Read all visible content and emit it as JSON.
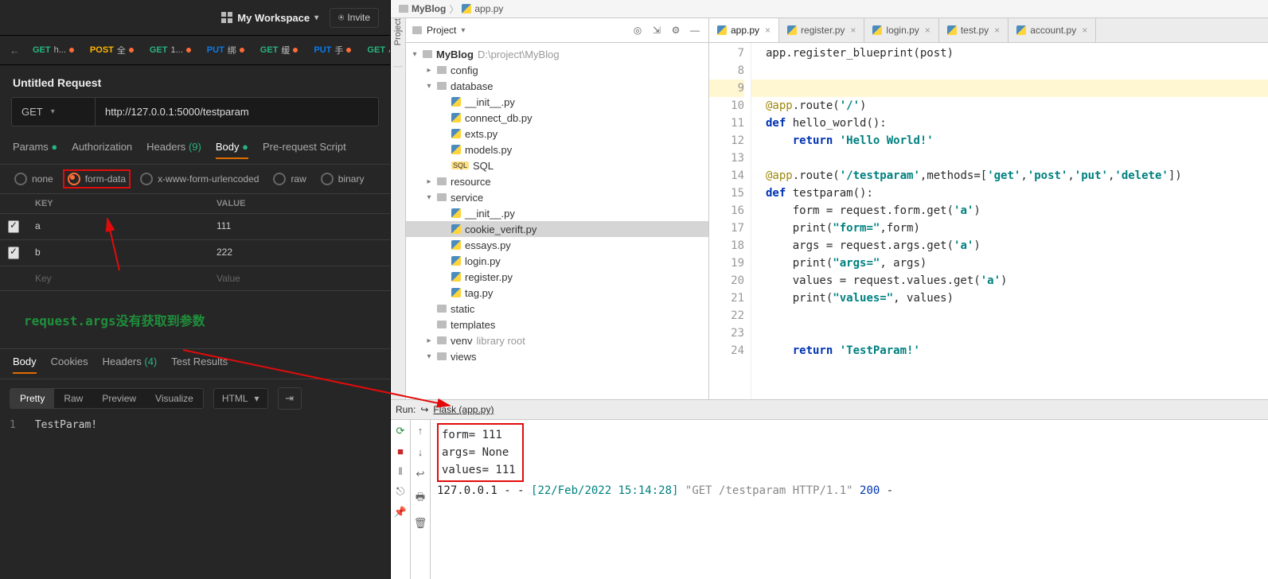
{
  "postman": {
    "workspace": "My Workspace",
    "invite": "Invite",
    "history": [
      {
        "method": "GET",
        "mclass": "m-get",
        "label": "h..."
      },
      {
        "method": "POST",
        "mclass": "m-post",
        "label": "全"
      },
      {
        "method": "GET",
        "mclass": "m-get",
        "label": "1..."
      },
      {
        "method": "PUT",
        "mclass": "m-put",
        "label": "绑"
      },
      {
        "method": "GET",
        "mclass": "m-get",
        "label": "缓"
      },
      {
        "method": "PUT",
        "mclass": "m-put",
        "label": "手"
      },
      {
        "method": "GET",
        "mclass": "m-get",
        "label": "小"
      }
    ],
    "request_title": "Untitled Request",
    "request_method": "GET",
    "request_url": "http://127.0.0.1:5000/testparam",
    "req_tabs": {
      "params": "Params",
      "authorization": "Authorization",
      "headers": "Headers",
      "headers_cnt": "(9)",
      "body": "Body",
      "prereq": "Pre-request Script"
    },
    "body_types": {
      "none": "none",
      "form": "form-data",
      "xwww": "x-www-form-urlencoded",
      "raw": "raw",
      "binary": "binary"
    },
    "grid": {
      "key_hdr": "KEY",
      "value_hdr": "VALUE",
      "rows": [
        {
          "key": "a",
          "value": "111"
        },
        {
          "key": "b",
          "value": "222"
        }
      ],
      "key_ph": "Key",
      "value_ph": "Value"
    },
    "annotation": "request.args没有获取到参数",
    "resp_tabs": {
      "body": "Body",
      "cookies": "Cookies",
      "headers": "Headers",
      "h_cnt": "(4)",
      "tests": "Test Results"
    },
    "view": {
      "pretty": "Pretty",
      "raw": "Raw",
      "preview": "Preview",
      "visualize": "Visualize",
      "fmt": "HTML"
    },
    "resp_line_no": "1",
    "resp_body": "TestParam!"
  },
  "ide": {
    "breadcrumb": {
      "folder": "MyBlog",
      "file": "app.py"
    },
    "side_label": "Project",
    "project_header": "Project",
    "tree": {
      "root": "MyBlog",
      "root_path": "D:\\project\\MyBlog",
      "config": "config",
      "database": "database",
      "db_init": "__init__.py",
      "db_conn": "connect_db.py",
      "db_exts": "exts.py",
      "db_models": "models.py",
      "db_sql": "SQL",
      "resource": "resource",
      "service": "service",
      "svc_init": "__init__.py",
      "svc_cookie": "cookie_verift.py",
      "svc_essays": "essays.py",
      "svc_login": "login.py",
      "svc_register": "register.py",
      "svc_tag": "tag.py",
      "static": "static",
      "templates": "templates",
      "venv": "venv",
      "venv_hint": "library root",
      "views": "views"
    },
    "tabs": [
      {
        "name": "app.py",
        "active": true
      },
      {
        "name": "register.py"
      },
      {
        "name": "login.py"
      },
      {
        "name": "test.py"
      },
      {
        "name": "account.py"
      }
    ],
    "line_start": 7,
    "code_lines": [
      "app.register_blueprint(post)",
      "",
      "",
      "@app.route('/')",
      "def hello_world():",
      "    return 'Hello World!'",
      "",
      "@app.route('/testparam',methods=['get','post','put','delete'])",
      "def testparam():",
      "    form = request.form.get('a')",
      "    print(\"form=\",form)",
      "    args = request.args.get('a')",
      "    print(\"args=\", args)",
      "    values = request.values.get('a')",
      "    print(\"values=\", values)",
      "",
      "",
      "    return 'TestParam!'"
    ],
    "run_label": "Run:",
    "run_config": "Flask (app.py)",
    "console": {
      "out": [
        "form= 111",
        "args= None",
        "values= 111"
      ],
      "log_ip": "127.0.0.1 - - ",
      "log_ts": "[22/Feb/2022 15:14:28] ",
      "log_req": "\"GET /testparam HTTP/1.1\" ",
      "log_status": "200",
      "log_tail": " -"
    }
  }
}
